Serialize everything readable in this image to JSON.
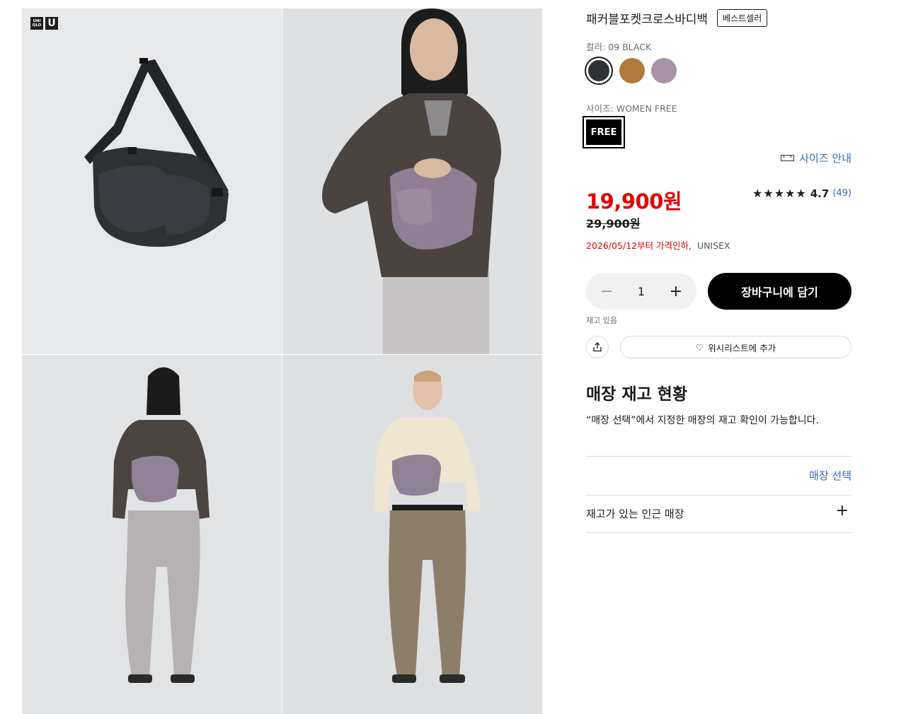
{
  "brand": {
    "logo_top": "UNI",
    "logo_bottom": "QLO",
    "logo_u": "U"
  },
  "product": {
    "title": "패커블포켓크로스바디백",
    "badge": "베스트셀러",
    "color_label": "컬러:",
    "color_value": "09 BLACK",
    "colors": [
      "#2f3134",
      "#b07a3e",
      "#a795a5"
    ],
    "size_label": "사이즈:",
    "size_value": "WOMEN FREE",
    "size_option": "FREE",
    "size_guide": "사이즈 안내",
    "price": "19,900원",
    "old_price": "29,900원",
    "rating_stars": "★★★★★",
    "rating_score": "4.7",
    "rating_count": "(49)",
    "rating_value": 4.7,
    "promo_text": "2026/05/12부터 가격인하,",
    "gender": "UNISEX",
    "quantity": "1",
    "qty_minus": "−",
    "qty_plus": "+",
    "add_to_cart": "장바구니에 담기",
    "stock_status": "재고 있음",
    "wishlist": "위시리스트에 추가",
    "wishlist_icon": "♡"
  },
  "store": {
    "title": "매장 재고 현황",
    "description": "“매장 선택”에서 지정한 매장의 재고 확인이 가능합니다.",
    "select_link": "매장 선택",
    "nearby_label": "재고가 있는 인근 매장",
    "expand_icon": "+"
  },
  "icons": {
    "ruler": "ruler-icon",
    "share": "share-icon",
    "heart": "heart-icon",
    "plus": "plus-icon"
  }
}
